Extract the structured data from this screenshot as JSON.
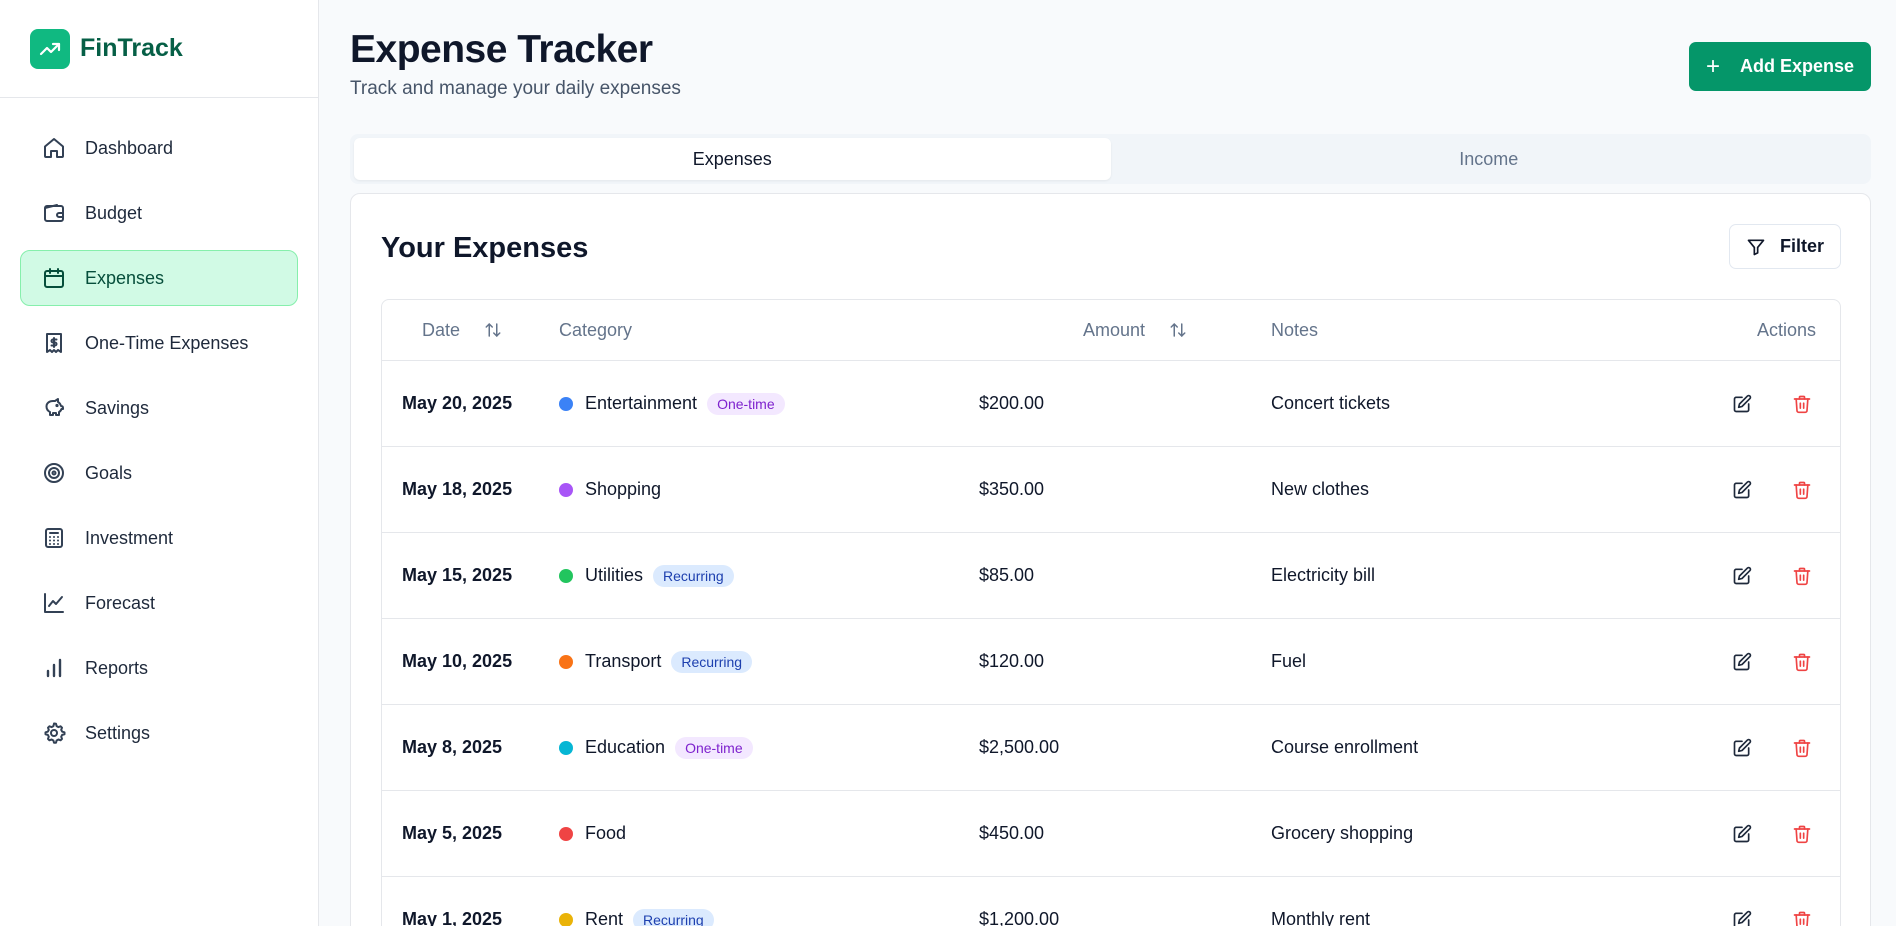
{
  "brand": {
    "name": "FinTrack",
    "color": "#10b981"
  },
  "sidebar": {
    "items": [
      {
        "label": "Dashboard",
        "icon": "home-icon",
        "active": false
      },
      {
        "label": "Budget",
        "icon": "wallet-icon",
        "active": false
      },
      {
        "label": "Expenses",
        "icon": "calendar-icon",
        "active": true
      },
      {
        "label": "One-Time Expenses",
        "icon": "receipt-icon",
        "active": false
      },
      {
        "label": "Savings",
        "icon": "piggy-bank-icon",
        "active": false
      },
      {
        "label": "Goals",
        "icon": "target-icon",
        "active": false
      },
      {
        "label": "Investment",
        "icon": "calculator-icon",
        "active": false
      },
      {
        "label": "Forecast",
        "icon": "line-chart-icon",
        "active": false
      },
      {
        "label": "Reports",
        "icon": "bar-chart-icon",
        "active": false
      },
      {
        "label": "Settings",
        "icon": "gear-icon",
        "active": false
      }
    ]
  },
  "header": {
    "title": "Expense Tracker",
    "subtitle": "Track and manage your daily expenses",
    "add_button": "Add Expense"
  },
  "tabs": [
    {
      "label": "Expenses",
      "active": true
    },
    {
      "label": "Income",
      "active": false
    }
  ],
  "expenses_card": {
    "title": "Your Expenses",
    "filter_label": "Filter",
    "columns": {
      "date": "Date",
      "category": "Category",
      "amount": "Amount",
      "notes": "Notes",
      "actions": "Actions"
    },
    "rows": [
      {
        "date": "May 20, 2025",
        "category": "Entertainment",
        "color": "#3b82f6",
        "badge": "One-time",
        "badge_type": "onetime",
        "amount": "$200.00",
        "notes": "Concert tickets"
      },
      {
        "date": "May 18, 2025",
        "category": "Shopping",
        "color": "#a855f7",
        "badge": "",
        "badge_type": "",
        "amount": "$350.00",
        "notes": "New clothes"
      },
      {
        "date": "May 15, 2025",
        "category": "Utilities",
        "color": "#22c55e",
        "badge": "Recurring",
        "badge_type": "recurring",
        "amount": "$85.00",
        "notes": "Electricity bill"
      },
      {
        "date": "May 10, 2025",
        "category": "Transport",
        "color": "#f97316",
        "badge": "Recurring",
        "badge_type": "recurring",
        "amount": "$120.00",
        "notes": "Fuel"
      },
      {
        "date": "May 8, 2025",
        "category": "Education",
        "color": "#06b6d4",
        "badge": "One-time",
        "badge_type": "onetime",
        "amount": "$2,500.00",
        "notes": "Course enrollment"
      },
      {
        "date": "May 5, 2025",
        "category": "Food",
        "color": "#ef4444",
        "badge": "",
        "badge_type": "",
        "amount": "$450.00",
        "notes": "Grocery shopping"
      },
      {
        "date": "May 1, 2025",
        "category": "Rent",
        "color": "#eab308",
        "badge": "Recurring",
        "badge_type": "recurring",
        "amount": "$1,200.00",
        "notes": "Monthly rent"
      }
    ]
  }
}
